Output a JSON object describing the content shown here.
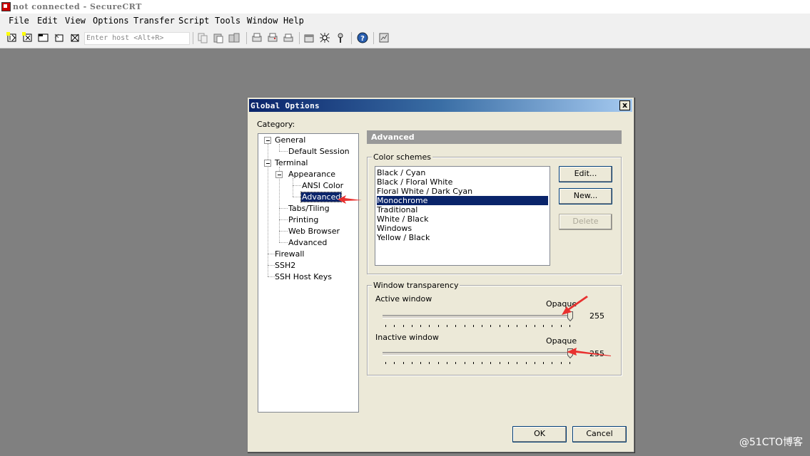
{
  "window": {
    "title": "not connected - SecureCRT"
  },
  "menu": [
    "File",
    "Edit",
    "View",
    "Options",
    "Transfer",
    "Script",
    "Tools",
    "Window",
    "Help"
  ],
  "toolbar": {
    "host_placeholder": "Enter host <Alt+R>",
    "icons": [
      "connect-icon",
      "quick-connect-icon",
      "connect-tab-icon",
      "reconnect-icon",
      "disconnect-icon",
      "copy-icon",
      "paste-icon",
      "copy-paste-icon",
      "find-icon",
      "print-icon",
      "print-selection-icon",
      "print-setup-icon",
      "session-options-icon",
      "global-options-icon",
      "keymap-icon",
      "help-icon",
      "about-icon"
    ]
  },
  "dialog": {
    "title": "Global Options",
    "close_label": "x",
    "category_label": "Category:",
    "tree": {
      "general": "General",
      "default_session": "Default Session",
      "terminal": "Terminal",
      "appearance": "Appearance",
      "ansi_color": "ANSI Color",
      "advanced_sel": "Advanced",
      "tabs_tiling": "Tabs/Tiling",
      "printing": "Printing",
      "web_browser": "Web Browser",
      "advanced": "Advanced",
      "firewall": "Firewall",
      "ssh2": "SSH2",
      "ssh_host_keys": "SSH Host Keys"
    },
    "panel_title": "Advanced",
    "color_schemes": {
      "label": "Color schemes",
      "items": [
        "Black / Cyan",
        "Black / Floral White",
        "Floral White / Dark Cyan",
        "Monochrome",
        "Traditional",
        "White / Black",
        "Windows",
        "Yellow / Black"
      ],
      "selected": "Monochrome",
      "edit_label": "Edit...",
      "new_label": "New...",
      "delete_label": "Delete"
    },
    "transparency": {
      "label": "Window transparency",
      "active_label": "Active window",
      "active_opaque": "Opaque",
      "active_value": "255",
      "inactive_label": "Inactive window",
      "inactive_opaque": "Opaque",
      "inactive_value": "255"
    },
    "ok_label": "OK",
    "cancel_label": "Cancel"
  },
  "watermark": "@51CTO博客",
  "colors": {
    "selection": "#0a246a",
    "arrow": "#e8312f",
    "dialog_bg": "#ece9d8",
    "desktop": "#808080"
  }
}
